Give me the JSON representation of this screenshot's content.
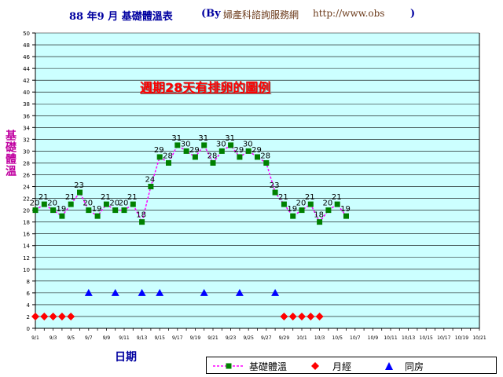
{
  "title": {
    "main": "88 年9 月 基礎體溫表",
    "by": "(By",
    "source": "婦產科諮詢服務網",
    "url": "http://www.obs",
    "closing": ")"
  },
  "colors": {
    "plot_background": "#ccffff",
    "bbt_line": "#ff00ff",
    "bbt_marker": "#008000",
    "menses_marker": "#ff0000",
    "intercourse_marker": "#0000ff",
    "grid": "#000000"
  },
  "chart_data": {
    "type": "line",
    "title": "88 年9 月 基礎體溫表",
    "ylabel": "基礎體溫",
    "xlabel": "日期",
    "annotation": "週期28天有排卵的圖例",
    "ylim": [
      0,
      50
    ],
    "ytick_step": 2,
    "grid": true,
    "legend_position": "bottom-right",
    "categories": [
      "9/1",
      "9/2",
      "9/3",
      "9/4",
      "9/5",
      "9/6",
      "9/7",
      "9/8",
      "9/9",
      "9/10",
      "9/11",
      "9/12",
      "9/13",
      "9/14",
      "9/15",
      "9/16",
      "9/17",
      "9/18",
      "9/19",
      "9/20",
      "9/21",
      "9/22",
      "9/23",
      "9/24",
      "9/25",
      "9/26",
      "9/27",
      "9/28",
      "9/29",
      "9/30",
      "10/1",
      "10/2",
      "10/3",
      "10/4",
      "10/5",
      "10/6",
      "10/7",
      "10/8",
      "10/9",
      "10/10",
      "10/11",
      "10/12",
      "10/13",
      "10/14",
      "10/15",
      "10/16",
      "10/17",
      "10/18",
      "10/19",
      "10/20",
      "10/21"
    ],
    "tick_labels": [
      "9/1",
      "9/3",
      "9/5",
      "9/7",
      "9/9",
      "9/11",
      "9/13",
      "9/15",
      "9/17",
      "9/19",
      "9/21",
      "9/23",
      "9/25",
      "9/27",
      "9/29",
      "10/1",
      "10/3",
      "10/5",
      "10/7",
      "10/9",
      "10/11",
      "10/13",
      "10/15",
      "10/17",
      "10/19",
      "10/21"
    ],
    "series": [
      {
        "name": "基礎體溫",
        "marker": "square",
        "values": [
          20,
          21,
          20,
          19,
          21,
          23,
          20,
          19,
          21,
          20,
          20,
          21,
          18,
          24,
          29,
          28,
          31,
          30,
          29,
          31,
          28,
          30,
          31,
          29,
          30,
          29,
          28,
          23,
          21,
          19,
          20,
          21,
          18,
          20,
          21,
          19
        ]
      },
      {
        "name": "月經",
        "marker": "diamond",
        "points": [
          {
            "x": "9/1",
            "y": 2
          },
          {
            "x": "9/2",
            "y": 2
          },
          {
            "x": "9/3",
            "y": 2
          },
          {
            "x": "9/4",
            "y": 2
          },
          {
            "x": "9/5",
            "y": 2
          },
          {
            "x": "9/29",
            "y": 2
          },
          {
            "x": "9/30",
            "y": 2
          },
          {
            "x": "10/1",
            "y": 2
          },
          {
            "x": "10/2",
            "y": 2
          },
          {
            "x": "10/3",
            "y": 2
          }
        ]
      },
      {
        "name": "同房",
        "marker": "triangle",
        "points": [
          {
            "x": "9/7",
            "y": 6
          },
          {
            "x": "9/10",
            "y": 6
          },
          {
            "x": "9/13",
            "y": 6
          },
          {
            "x": "9/15",
            "y": 6
          },
          {
            "x": "9/20",
            "y": 6
          },
          {
            "x": "9/24",
            "y": 6
          },
          {
            "x": "9/28",
            "y": 6
          }
        ]
      }
    ]
  }
}
